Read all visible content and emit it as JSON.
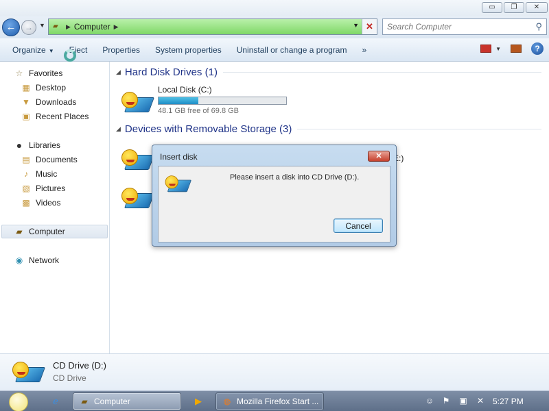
{
  "window": {
    "minimize_glyph": "▭",
    "maximize_glyph": "❐",
    "close_glyph": "✕"
  },
  "address_bar": {
    "back_glyph": "←",
    "forward_glyph": "→",
    "crumb": "Computer",
    "close_glyph": "✕"
  },
  "search": {
    "placeholder": "Search Computer"
  },
  "toolbar": {
    "organize": "Organize",
    "eject": "Eject",
    "properties": "Properties",
    "system_properties": "System properties",
    "uninstall": "Uninstall or change a program",
    "more": "»",
    "help": "?"
  },
  "nav": {
    "favorites": "Favorites",
    "desktop": "Desktop",
    "downloads": "Downloads",
    "recent_places": "Recent Places",
    "libraries": "Libraries",
    "documents": "Documents",
    "music": "Music",
    "pictures": "Pictures",
    "videos": "Videos",
    "computer": "Computer",
    "network": "Network"
  },
  "content": {
    "hdd_group": "Hard Disk Drives (1)",
    "removable_group": "Devices with Removable Storage (3)",
    "local_disk": {
      "name": "Local Disk (C:)",
      "free_text": "48.1 GB free of 69.8 GB",
      "used_fraction": 0.311
    },
    "partial_label": "E:)"
  },
  "dialog": {
    "title": "Insert disk",
    "close_glyph": "✕",
    "message": "Please insert a disk into CD Drive (D:).",
    "cancel": "Cancel"
  },
  "details": {
    "name": "CD Drive (D:)",
    "type": "CD Drive"
  },
  "taskbar": {
    "task_computer": "Computer",
    "task_firefox": "Mozilla Firefox Start ...",
    "clock": "5:27 PM"
  }
}
